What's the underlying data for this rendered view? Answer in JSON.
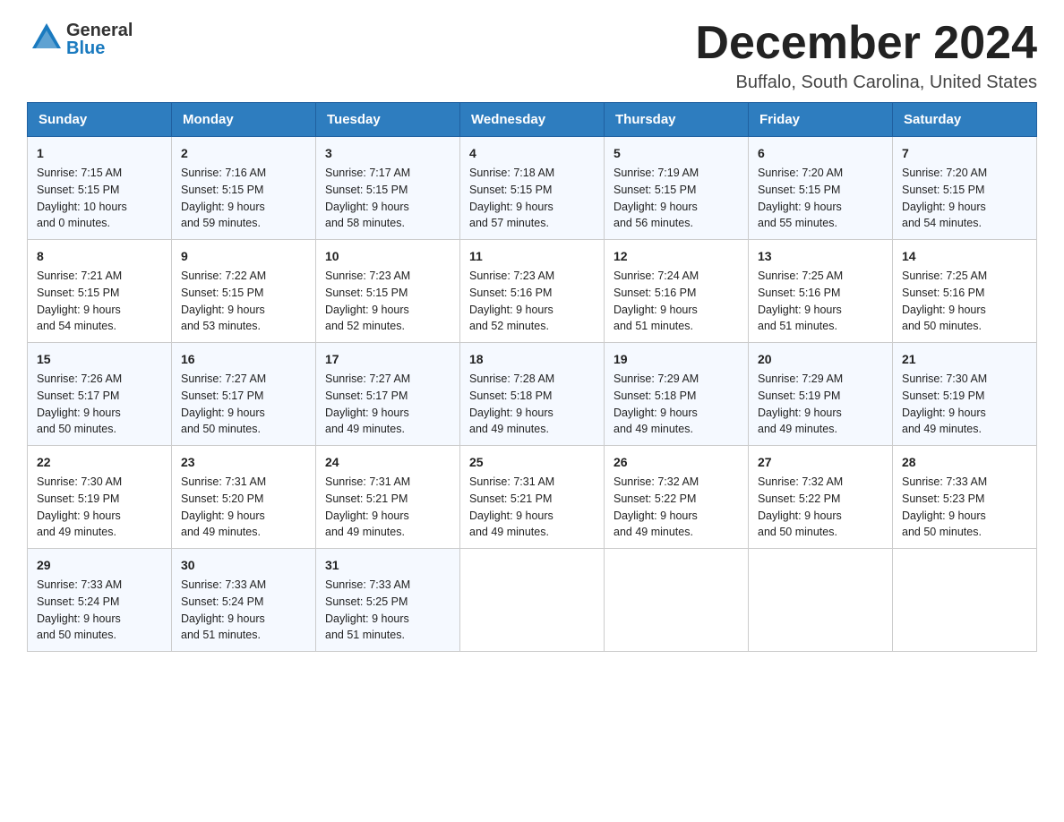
{
  "header": {
    "logo_text_general": "General",
    "logo_text_blue": "Blue",
    "month_title": "December 2024",
    "location": "Buffalo, South Carolina, United States"
  },
  "weekdays": [
    "Sunday",
    "Monday",
    "Tuesday",
    "Wednesday",
    "Thursday",
    "Friday",
    "Saturday"
  ],
  "weeks": [
    [
      {
        "day": "1",
        "sunrise": "7:15 AM",
        "sunset": "5:15 PM",
        "daylight": "10 hours and 0 minutes."
      },
      {
        "day": "2",
        "sunrise": "7:16 AM",
        "sunset": "5:15 PM",
        "daylight": "9 hours and 59 minutes."
      },
      {
        "day": "3",
        "sunrise": "7:17 AM",
        "sunset": "5:15 PM",
        "daylight": "9 hours and 58 minutes."
      },
      {
        "day": "4",
        "sunrise": "7:18 AM",
        "sunset": "5:15 PM",
        "daylight": "9 hours and 57 minutes."
      },
      {
        "day": "5",
        "sunrise": "7:19 AM",
        "sunset": "5:15 PM",
        "daylight": "9 hours and 56 minutes."
      },
      {
        "day": "6",
        "sunrise": "7:20 AM",
        "sunset": "5:15 PM",
        "daylight": "9 hours and 55 minutes."
      },
      {
        "day": "7",
        "sunrise": "7:20 AM",
        "sunset": "5:15 PM",
        "daylight": "9 hours and 54 minutes."
      }
    ],
    [
      {
        "day": "8",
        "sunrise": "7:21 AM",
        "sunset": "5:15 PM",
        "daylight": "9 hours and 54 minutes."
      },
      {
        "day": "9",
        "sunrise": "7:22 AM",
        "sunset": "5:15 PM",
        "daylight": "9 hours and 53 minutes."
      },
      {
        "day": "10",
        "sunrise": "7:23 AM",
        "sunset": "5:15 PM",
        "daylight": "9 hours and 52 minutes."
      },
      {
        "day": "11",
        "sunrise": "7:23 AM",
        "sunset": "5:16 PM",
        "daylight": "9 hours and 52 minutes."
      },
      {
        "day": "12",
        "sunrise": "7:24 AM",
        "sunset": "5:16 PM",
        "daylight": "9 hours and 51 minutes."
      },
      {
        "day": "13",
        "sunrise": "7:25 AM",
        "sunset": "5:16 PM",
        "daylight": "9 hours and 51 minutes."
      },
      {
        "day": "14",
        "sunrise": "7:25 AM",
        "sunset": "5:16 PM",
        "daylight": "9 hours and 50 minutes."
      }
    ],
    [
      {
        "day": "15",
        "sunrise": "7:26 AM",
        "sunset": "5:17 PM",
        "daylight": "9 hours and 50 minutes."
      },
      {
        "day": "16",
        "sunrise": "7:27 AM",
        "sunset": "5:17 PM",
        "daylight": "9 hours and 50 minutes."
      },
      {
        "day": "17",
        "sunrise": "7:27 AM",
        "sunset": "5:17 PM",
        "daylight": "9 hours and 49 minutes."
      },
      {
        "day": "18",
        "sunrise": "7:28 AM",
        "sunset": "5:18 PM",
        "daylight": "9 hours and 49 minutes."
      },
      {
        "day": "19",
        "sunrise": "7:29 AM",
        "sunset": "5:18 PM",
        "daylight": "9 hours and 49 minutes."
      },
      {
        "day": "20",
        "sunrise": "7:29 AM",
        "sunset": "5:19 PM",
        "daylight": "9 hours and 49 minutes."
      },
      {
        "day": "21",
        "sunrise": "7:30 AM",
        "sunset": "5:19 PM",
        "daylight": "9 hours and 49 minutes."
      }
    ],
    [
      {
        "day": "22",
        "sunrise": "7:30 AM",
        "sunset": "5:19 PM",
        "daylight": "9 hours and 49 minutes."
      },
      {
        "day": "23",
        "sunrise": "7:31 AM",
        "sunset": "5:20 PM",
        "daylight": "9 hours and 49 minutes."
      },
      {
        "day": "24",
        "sunrise": "7:31 AM",
        "sunset": "5:21 PM",
        "daylight": "9 hours and 49 minutes."
      },
      {
        "day": "25",
        "sunrise": "7:31 AM",
        "sunset": "5:21 PM",
        "daylight": "9 hours and 49 minutes."
      },
      {
        "day": "26",
        "sunrise": "7:32 AM",
        "sunset": "5:22 PM",
        "daylight": "9 hours and 49 minutes."
      },
      {
        "day": "27",
        "sunrise": "7:32 AM",
        "sunset": "5:22 PM",
        "daylight": "9 hours and 50 minutes."
      },
      {
        "day": "28",
        "sunrise": "7:33 AM",
        "sunset": "5:23 PM",
        "daylight": "9 hours and 50 minutes."
      }
    ],
    [
      {
        "day": "29",
        "sunrise": "7:33 AM",
        "sunset": "5:24 PM",
        "daylight": "9 hours and 50 minutes."
      },
      {
        "day": "30",
        "sunrise": "7:33 AM",
        "sunset": "5:24 PM",
        "daylight": "9 hours and 51 minutes."
      },
      {
        "day": "31",
        "sunrise": "7:33 AM",
        "sunset": "5:25 PM",
        "daylight": "9 hours and 51 minutes."
      },
      null,
      null,
      null,
      null
    ]
  ],
  "labels": {
    "sunrise": "Sunrise:",
    "sunset": "Sunset:",
    "daylight": "Daylight:"
  }
}
